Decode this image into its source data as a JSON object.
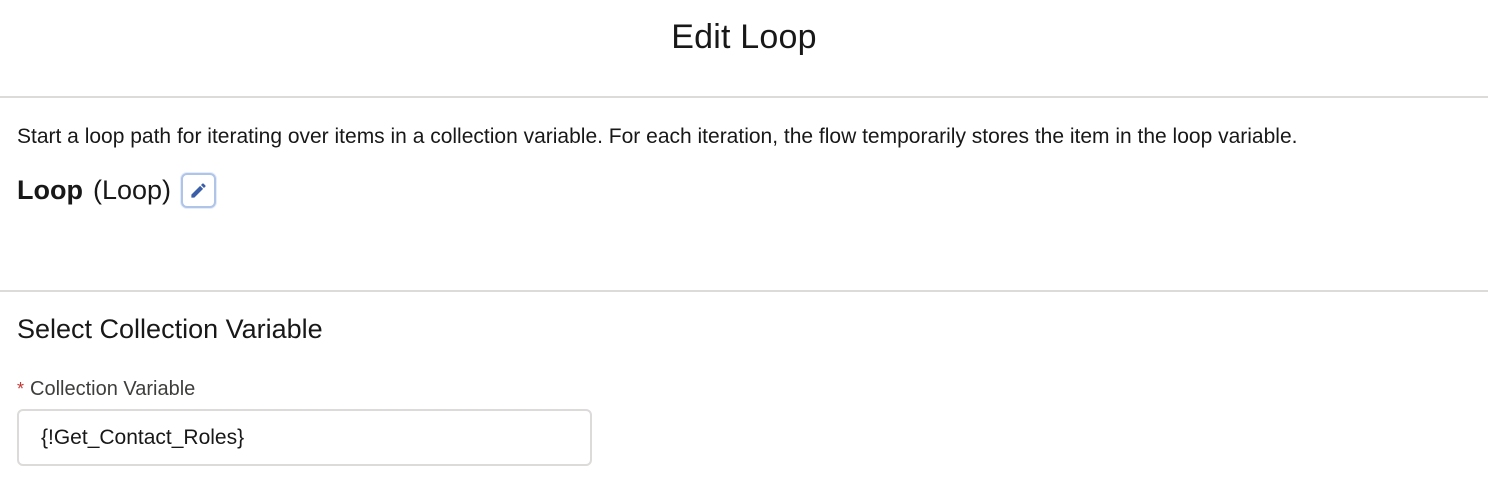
{
  "header": {
    "title": "Edit Loop"
  },
  "info": {
    "description": "Start a loop path for iterating over items in a collection variable. For each iteration, the flow temporarily stores the item in the loop variable.",
    "element_label": "Loop",
    "element_api_name": "(Loop)",
    "edit_icon": "pencil-icon"
  },
  "collection": {
    "section_title": "Select Collection Variable",
    "required_marker": "*",
    "field_label": "Collection Variable",
    "field_value": "{!Get_Contact_Roles}"
  },
  "colors": {
    "required": "#c23934",
    "divider": "#dddbda",
    "edit_icon": "#3b5ea8"
  }
}
